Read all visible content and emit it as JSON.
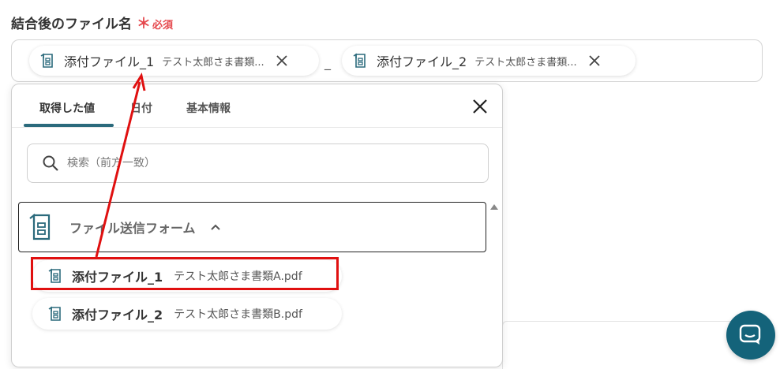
{
  "field": {
    "label": "結合後のファイル名",
    "required_mark": "＊",
    "required_text": "必須",
    "separator": "_"
  },
  "chips": [
    {
      "name": "添付ファイル_1",
      "value": "テスト太郎さま書類..."
    },
    {
      "name": "添付ファイル_2",
      "value": "テスト太郎さま書類..."
    }
  ],
  "dropdown": {
    "tabs": [
      {
        "label": "取得した値",
        "active": true
      },
      {
        "label": "日付",
        "active": false
      },
      {
        "label": "基本情報",
        "active": false
      }
    ],
    "search": {
      "placeholder": "検索（前方一致）"
    },
    "group": {
      "label": "ファイル送信フォーム"
    },
    "options": [
      {
        "name": "添付ファイル_1",
        "value": "テスト太郎さま書類A.pdf"
      },
      {
        "name": "添付ファイル_2",
        "value": "テスト太郎さま書類B.pdf"
      }
    ]
  },
  "colors": {
    "accent": "#2b6a7c",
    "required": "#e5484d",
    "annotation": "#e01010",
    "chat_button": "#14637a"
  }
}
